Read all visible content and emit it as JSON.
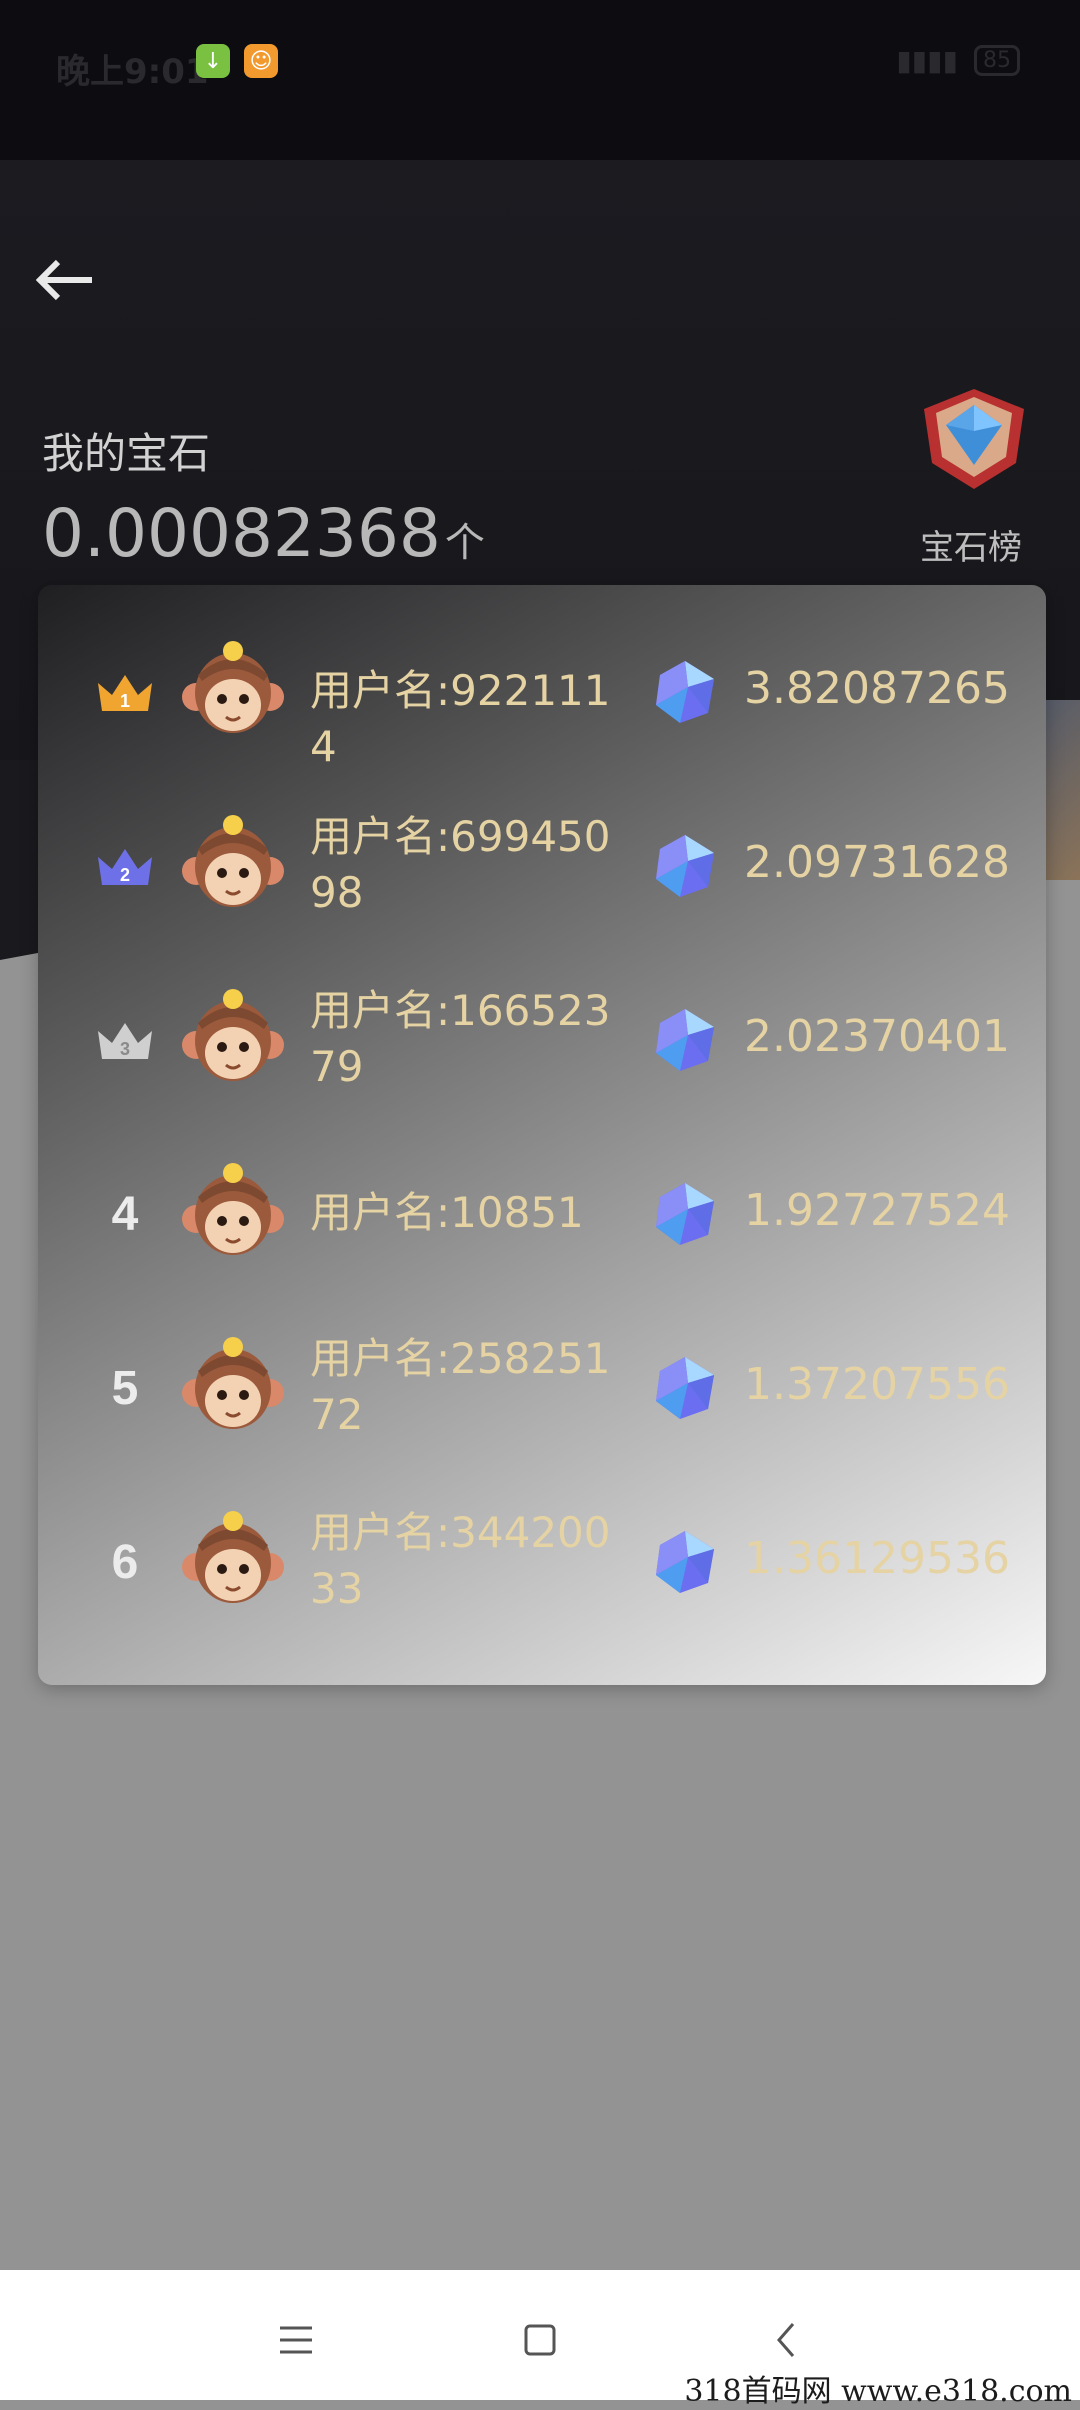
{
  "status_bar": {
    "time": "晚上9:01",
    "battery": "85"
  },
  "header": {
    "my_gems_label": "我的宝石",
    "my_gems_value": "0.00082368",
    "my_gems_unit": "个",
    "rank_link_label": "宝石榜"
  },
  "leaderboard": [
    {
      "rank": "1",
      "name": "用户名:9221114",
      "value": "3.82087265",
      "crown_color": "#f1a531"
    },
    {
      "rank": "2",
      "name": "用户名:69945098",
      "value": "2.09731628",
      "crown_color": "#6e70e8"
    },
    {
      "rank": "3",
      "name": "用户名:16652379",
      "value": "2.02370401",
      "crown_color": "#cfcfcf"
    },
    {
      "rank": "4",
      "name": "用户名:10851",
      "value": "1.92727524"
    },
    {
      "rank": "5",
      "name": "用户名:25825172",
      "value": "1.37207556"
    },
    {
      "rank": "6",
      "name": "用户名:34420033",
      "value": "1.36129536"
    }
  ],
  "watermark": "318首码网  www.e318.com",
  "icons": {
    "back": "back-arrow-icon",
    "rank_badge": "gem-badge-icon",
    "avatar": "monkey-avatar-icon",
    "gem": "gem-icon",
    "nav_menu": "menu-icon",
    "nav_home": "home-square-icon",
    "nav_back": "chevron-left-icon"
  }
}
